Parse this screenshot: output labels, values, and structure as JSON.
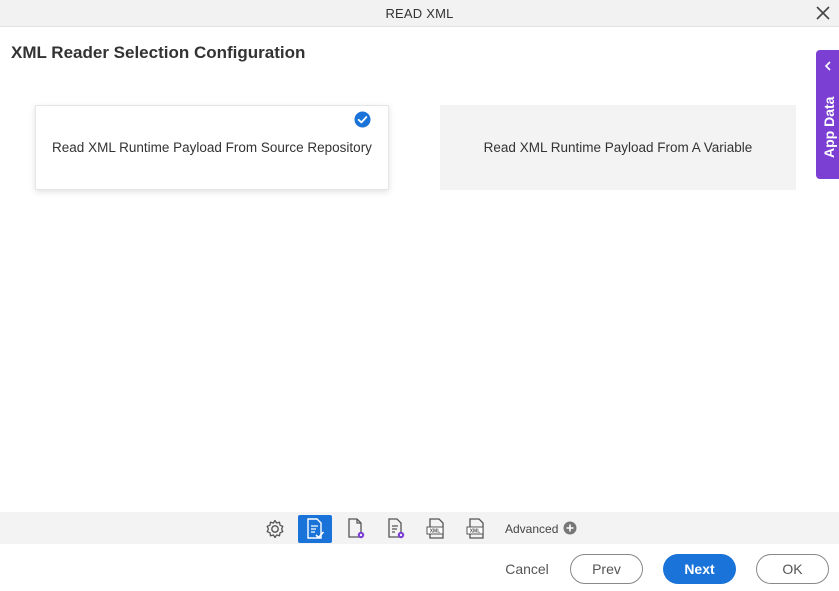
{
  "window": {
    "title": "READ XML"
  },
  "page": {
    "title": "XML Reader Selection Configuration"
  },
  "options": [
    {
      "label": "Read XML Runtime Payload From Source Repository",
      "selected": true
    },
    {
      "label": "Read XML Runtime Payload From A Variable",
      "selected": false
    }
  ],
  "side_panel": {
    "label": "App Data"
  },
  "toolbar": {
    "icons": [
      "gear-icon",
      "document-check-icon",
      "document-settings-icon",
      "document-list-settings-icon",
      "xml-file-icon",
      "xml-file-alt-icon"
    ],
    "active_index": 1,
    "advanced_label": "Advanced"
  },
  "footer": {
    "cancel_label": "Cancel",
    "prev_label": "Prev",
    "next_label": "Next",
    "ok_label": "OK"
  },
  "colors": {
    "accent": "#1a73d9",
    "side_panel": "#7b3fd3"
  }
}
